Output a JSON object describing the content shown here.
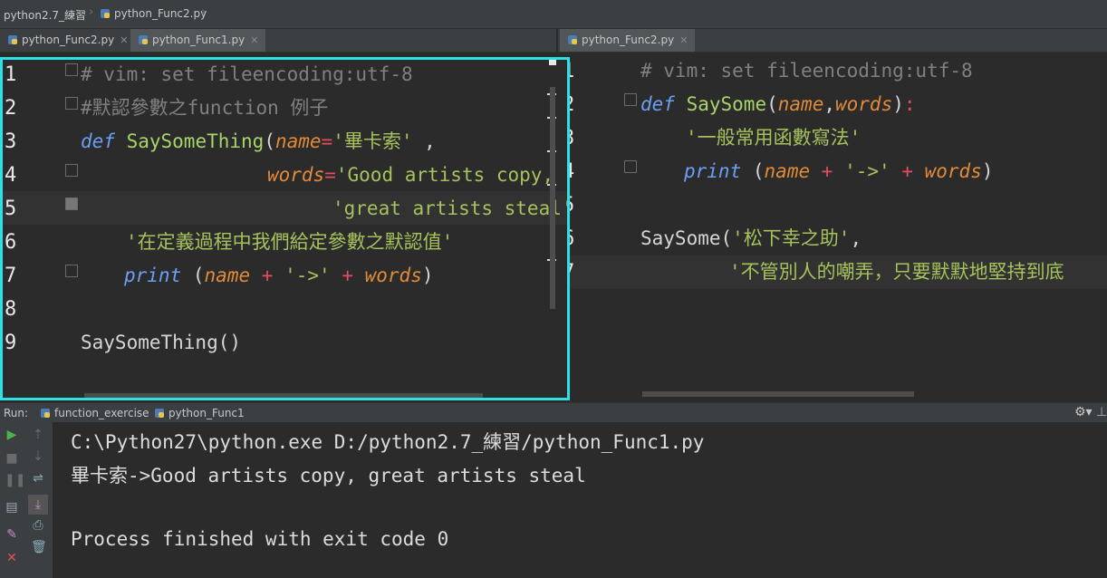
{
  "breadcrumb": {
    "project": "python2.7_練習",
    "file": "python_Func2.py"
  },
  "left_tabs": [
    {
      "label": "python_Func2.py",
      "active": false
    },
    {
      "label": "python_Func1.py",
      "active": true
    }
  ],
  "right_tabs": [
    {
      "label": "python_Func2.py",
      "active": true
    }
  ],
  "left_editor": {
    "line_numbers": [
      "1",
      "2",
      "3",
      "4",
      "5",
      "6",
      "7",
      "8",
      "9"
    ],
    "lines": {
      "l1": "# vim: set fileencoding:utf-8",
      "l2": "#默認參數之function 例子",
      "l3_def": "def",
      "l3_name": "SaySomeThing",
      "l3_p1": "name",
      "l3_v1": "'畢卡索'",
      "l4_p2": "words",
      "l4_v2": "'Good artists copy, '",
      "l5_v2": "'great artists steal'",
      "l6_doc": "'在定義過程中我們給定參數之默認值'",
      "l7_print": "print",
      "l7_name": "name",
      "l7_arrow": "'->'",
      "l7_words": "words",
      "l9_call": "SaySomeThing()"
    }
  },
  "right_editor": {
    "line_numbers": [
      "1",
      "2",
      "3",
      "4",
      "5",
      "6",
      "7"
    ],
    "lines": {
      "l1": "# vim: set fileencoding:utf-8",
      "l2_def": "def",
      "l2_name": "SaySome",
      "l2_p1": "name",
      "l2_p2": "words",
      "l3_doc": "'一般常用函數寫法'",
      "l4_print": "print",
      "l4_name": "name",
      "l4_arrow": "'->'",
      "l4_words": "words",
      "l6_call": "SaySome(",
      "l6_arg1": "'松下幸之助'",
      "l7_arg2": "'不管別人的嘲弄，只要默默地堅持到底"
    }
  },
  "run_panel": {
    "label": "Run:",
    "tabs": [
      "function_exercise",
      "python_Func1"
    ]
  },
  "console": {
    "lines": [
      "C:\\Python27\\python.exe D:/python2.7_練習/python_Func1.py",
      "畢卡索->Good artists copy, great artists steal",
      "",
      "Process finished with exit code 0"
    ]
  },
  "icons": {
    "run": "play-icon",
    "stop": "stop-icon",
    "pause": "pause-icon",
    "up": "arrow-up-icon",
    "down": "arrow-down-icon",
    "settings": "gear-icon"
  },
  "colors": {
    "focus_border": "#2de0e6",
    "keyword": "#6a9ff5",
    "string": "#a5c25c",
    "param": "#e18a3a"
  }
}
